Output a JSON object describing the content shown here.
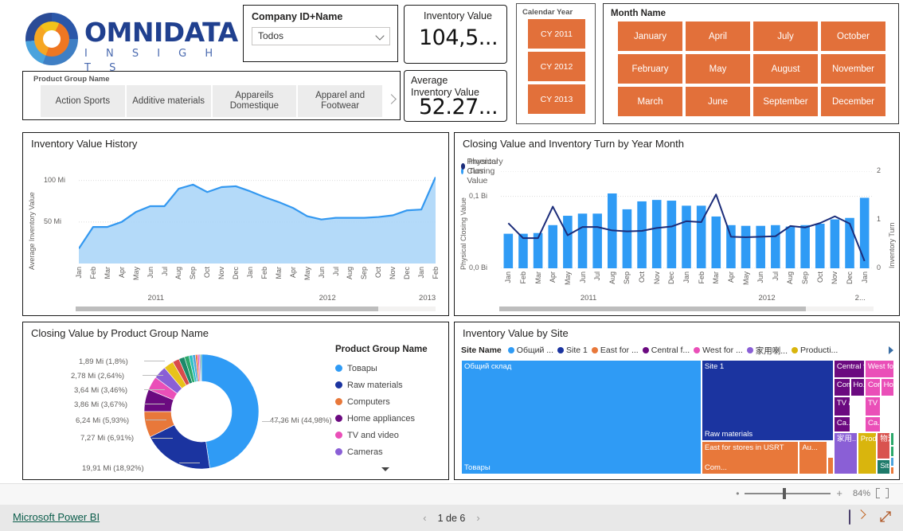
{
  "brand": {
    "name": "OMNIDATA",
    "tagline": "I N S I G H T S",
    "logo_icon": "donut-logo-icon",
    "colors": {
      "dark_blue": "#2a4b96",
      "mid_blue": "#3f7fc4",
      "light_blue": "#4aa3dd",
      "orange": "#ef7722",
      "yellow": "#f2c21a"
    }
  },
  "company_slicer": {
    "label": "Company ID+Name",
    "value": "Todos",
    "chevron": "chevron-down-icon"
  },
  "product_group_slicer": {
    "label": "Product Group Name",
    "tiles": [
      "Action Sports",
      "Additive materials",
      "Appareils Domestique",
      "Apparel and Footwear"
    ],
    "next_icon": "chevron-right-icon"
  },
  "kpi_cards": [
    {
      "label": "Inventory Value",
      "value": "104,5..."
    },
    {
      "label": "Average Inventory Value",
      "value": "52.27..."
    }
  ],
  "calendar_year_slicer": {
    "label": "Calendar Year",
    "items": [
      "CY 2011",
      "CY 2012",
      "CY 2013"
    ],
    "tile_color": "#e2703a"
  },
  "month_slicer": {
    "label": "Month Name",
    "items": [
      "January",
      "April",
      "July",
      "October",
      "February",
      "May",
      "August",
      "November",
      "March",
      "June",
      "September",
      "December"
    ],
    "tile_color": "#e2703a"
  },
  "chart_data": [
    {
      "type": "area",
      "title": "Inventory Value History",
      "xlabel": "",
      "ylabel": "Average Inventory Value",
      "ylim": [
        0,
        115
      ],
      "yticks": [
        "50 Mi",
        "100 Mi"
      ],
      "ytick_values": [
        50,
        100
      ],
      "grid": true,
      "series_color": "#3398f0",
      "fill_color": "#a7d4f8",
      "x_groups": [
        {
          "year": "2011",
          "months": [
            "Jan",
            "Feb",
            "Mar",
            "Apr",
            "May",
            "Jun",
            "Jul",
            "Aug",
            "Sep",
            "Oct",
            "Nov",
            "Dec"
          ]
        },
        {
          "year": "2012",
          "months": [
            "Jan",
            "Feb",
            "Mar",
            "Apr",
            "May",
            "Jun",
            "Jul",
            "Aug",
            "Sep",
            "Oct",
            "Nov",
            "Dec"
          ]
        },
        {
          "year": "2013",
          "months": [
            "Jan",
            "Feb"
          ]
        }
      ],
      "categories": [
        "2011 Jan",
        "2011 Feb",
        "2011 Mar",
        "2011 Apr",
        "2011 May",
        "2011 Jun",
        "2011 Jul",
        "2011 Aug",
        "2011 Sep",
        "2011 Oct",
        "2011 Nov",
        "2011 Dec",
        "2012 Jan",
        "2012 Feb",
        "2012 Mar",
        "2012 Apr",
        "2012 May",
        "2012 Jun",
        "2012 Jul",
        "2012 Aug",
        "2012 Sep",
        "2012 Oct",
        "2012 Nov",
        "2012 Dec",
        "2013 Jan",
        "2013 Feb"
      ],
      "values": [
        18,
        44,
        44,
        50,
        62,
        69,
        69,
        90,
        95,
        86,
        92,
        93,
        87,
        80,
        74,
        67,
        57,
        53,
        55,
        55,
        55,
        56,
        58,
        64,
        65,
        104
      ],
      "scrollbar": {
        "position": 0,
        "extent": 0.84
      }
    },
    {
      "type": "bar+line",
      "title": "Closing Value and Inventory Turn by Year Month",
      "legend": [
        {
          "label": "Physical Closing Value",
          "color": "#2f9bf5"
        },
        {
          "label": "Inventory Turn",
          "color": "#1c2d7a"
        }
      ],
      "legend_position": "top",
      "ylabel_left": "Physical Closing Value",
      "ylabel_right": "Inventory Turn",
      "yticks_left": [
        "0,0 Bi",
        "0,1 Bi"
      ],
      "ytick_left_values": [
        0.0,
        0.1
      ],
      "ylim_left": [
        0,
        0.135
      ],
      "yticks_right": [
        "0",
        "1",
        "2"
      ],
      "ytick_right_values": [
        0,
        1,
        2
      ],
      "ylim_right": [
        0,
        2
      ],
      "grid": true,
      "x_groups": [
        {
          "year": "2011",
          "months": [
            "Jan",
            "Feb",
            "Mar",
            "Apr",
            "May",
            "Jun",
            "Jul",
            "Aug",
            "Sep",
            "Oct",
            "Nov",
            "Dec"
          ]
        },
        {
          "year": "2012",
          "months": [
            "Jan",
            "Feb",
            "Mar",
            "Apr",
            "May",
            "Jun",
            "Jul",
            "Aug",
            "Sep",
            "Oct",
            "Nov",
            "Dec"
          ]
        },
        {
          "year": "2...",
          "months": [
            "Jan"
          ]
        }
      ],
      "categories": [
        "2011 Jan",
        "2011 Feb",
        "2011 Mar",
        "2011 Apr",
        "2011 May",
        "2011 Jun",
        "2011 Jul",
        "2011 Aug",
        "2011 Sep",
        "2011 Oct",
        "2011 Nov",
        "2011 Dec",
        "2012 Jan",
        "2012 Feb",
        "2012 Mar",
        "2012 Apr",
        "2012 May",
        "2012 Jun",
        "2012 Jul",
        "2012 Aug",
        "2012 Sep",
        "2012 Oct",
        "2012 Nov",
        "2012 Dec",
        "2013 Jan"
      ],
      "series": [
        {
          "name": "Physical Closing Value",
          "type": "bar",
          "axis": "left",
          "values": [
            0.048,
            0.048,
            0.049,
            0.06,
            0.073,
            0.076,
            0.076,
            0.104,
            0.082,
            0.093,
            0.095,
            0.094,
            0.087,
            0.087,
            0.072,
            0.06,
            0.059,
            0.059,
            0.06,
            0.058,
            0.06,
            0.062,
            0.068,
            0.07,
            0.098
          ]
        },
        {
          "name": "Inventory Turn",
          "type": "line",
          "axis": "right",
          "values": [
            0.93,
            0.62,
            0.62,
            1.27,
            0.68,
            0.85,
            0.85,
            0.78,
            0.76,
            0.77,
            0.83,
            0.86,
            0.97,
            0.95,
            1.52,
            0.65,
            0.64,
            0.65,
            0.66,
            0.87,
            0.84,
            0.93,
            1.07,
            0.92,
            0.15
          ]
        }
      ],
      "scrollbar": {
        "position": 0,
        "extent": 0.82
      }
    },
    {
      "type": "pie",
      "title": "Closing Value by Product Group Name",
      "legend_title": "Product Group Name",
      "legend_position": "right",
      "donut": true,
      "labels": [
        "47,36 Mi (44,98%)",
        "19,91 Mi (18,92%)",
        "7,27 Mi (6,91%)",
        "6,24 Mi (5,93%)",
        "3,86 Mi (3,67%)",
        "3,64 Mi (3,46%)",
        "2,78 Mi (2,64%)",
        "1,89 Mi (1,8%)"
      ],
      "slices": [
        {
          "name": "Товары",
          "value": 47.36,
          "percent": 44.98,
          "color": "#2f9bf5",
          "label": "47,36 Mi (44,98%)"
        },
        {
          "name": "Raw materials",
          "value": 19.91,
          "percent": 18.92,
          "color": "#1b34a0",
          "label": "19,91 Mi (18,92%)"
        },
        {
          "name": "Computers",
          "value": 7.27,
          "percent": 6.91,
          "color": "#e8783a",
          "label": "7,27 Mi (6,91%)"
        },
        {
          "name": "Home appliances",
          "value": 6.24,
          "percent": 5.93,
          "color": "#6b0a80",
          "label": "6,24 Mi (5,93%)"
        },
        {
          "name": "TV and video",
          "value": 3.86,
          "percent": 3.67,
          "color": "#ea4fb8",
          "label": "3,86 Mi (3,67%)"
        },
        {
          "name": "Cameras",
          "value": 3.64,
          "percent": 3.46,
          "color": "#8a5fd6",
          "label": "3,64 Mi (3,46%)"
        },
        {
          "name": "",
          "value": 2.78,
          "percent": 2.64,
          "color": "#e8c21a",
          "label": "2,78 Mi (2,64%)"
        },
        {
          "name": "",
          "value": 1.89,
          "percent": 1.8,
          "color": "#d94b4b",
          "label": "1,89 Mi (1,8%)"
        },
        {
          "name": "",
          "value": 1.6,
          "percent": 1.5,
          "color": "#1d8a6a",
          "color_note": "small",
          "label": ""
        },
        {
          "name": "",
          "value": 1.3,
          "percent": 1.2,
          "color": "#2aa86a",
          "label": ""
        },
        {
          "name": "",
          "value": 1.0,
          "percent": 0.95,
          "color": "#2fc0c0",
          "label": ""
        },
        {
          "name": "",
          "value": 0.8,
          "percent": 0.76,
          "color": "#4aa3dd",
          "label": ""
        },
        {
          "name": "",
          "value": 0.6,
          "percent": 0.57,
          "color": "#e8783a",
          "label": ""
        },
        {
          "name": "",
          "value": 0.45,
          "percent": 0.43,
          "color": "#ea4fb8",
          "label": ""
        },
        {
          "name": "",
          "value": 0.35,
          "percent": 0.33,
          "color": "#8a5fd6",
          "label": ""
        },
        {
          "name": "",
          "value": 0.3,
          "percent": 0.28,
          "color": "#2aa86a",
          "label": ""
        }
      ],
      "legend_items": [
        {
          "label": "Товары",
          "color": "#2f9bf5"
        },
        {
          "label": "Raw materials",
          "color": "#1b34a0"
        },
        {
          "label": "Computers",
          "color": "#e8783a"
        },
        {
          "label": "Home appliances",
          "color": "#6b0a80"
        },
        {
          "label": "TV and video",
          "color": "#ea4fb8"
        },
        {
          "label": "Cameras",
          "color": "#8a5fd6"
        }
      ],
      "more_icon": "chevron-down-icon"
    },
    {
      "type": "treemap",
      "title": "Inventory Value by Site",
      "legend_title": "Site Name",
      "legend_items": [
        {
          "label": "Общий ...",
          "color": "#2f9bf5"
        },
        {
          "label": "Site 1",
          "color": "#1b34a0"
        },
        {
          "label": "East for ...",
          "color": "#e8783a"
        },
        {
          "label": "Central f...",
          "color": "#6b0a80"
        },
        {
          "label": "West for ...",
          "color": "#ea4fb8"
        },
        {
          "label": "家用喇...",
          "color": "#8a5fd6"
        },
        {
          "label": "Producti...",
          "color": "#d9b50d"
        }
      ],
      "legend_next_icon": "triangle-right-icon",
      "cells": [
        {
          "label": "Общий склад",
          "sublabel": "Товары",
          "color": "#2f9bf5",
          "x": 0,
          "y": 0,
          "w": 55.5,
          "h": 100
        },
        {
          "label": "Site 1",
          "sublabel": "Raw materials",
          "color": "#1b34a0",
          "x": 55.5,
          "y": 0,
          "w": 30.5,
          "h": 71
        },
        {
          "label": "East for stores in USRT",
          "sublabel": "Com...",
          "color": "#e8783a",
          "x": 55.5,
          "y": 71,
          "w": 22.5,
          "h": 29
        },
        {
          "label": "Au...",
          "color": "#e8783a",
          "x": 78,
          "y": 71,
          "w": 6.5,
          "h": 29
        },
        {
          "label": "",
          "color": "#e8783a",
          "x": 84.5,
          "y": 85,
          "w": 1.5,
          "h": 15
        },
        {
          "label": "Central for...",
          "color": "#6b0a80",
          "x": 86,
          "y": 0,
          "w": 7.2,
          "h": 16
        },
        {
          "label": "Com...",
          "color": "#6b0a80",
          "x": 86,
          "y": 16,
          "w": 3.8,
          "h": 16
        },
        {
          "label": "Ho...",
          "color": "#6b0a80",
          "x": 89.8,
          "y": 16,
          "w": 3.4,
          "h": 16
        },
        {
          "label": "TV a...",
          "color": "#6b0a80",
          "x": 86,
          "y": 32,
          "w": 3.8,
          "h": 17
        },
        {
          "label": "Ca...",
          "color": "#6b0a80",
          "x": 86,
          "y": 49,
          "w": 3.8,
          "h": 14
        },
        {
          "label": "West for s...",
          "color": "#ea4fb8",
          "x": 93.2,
          "y": 0,
          "w": 6.8,
          "h": 16
        },
        {
          "label": "Com...",
          "color": "#ea4fb8",
          "x": 93.2,
          "y": 16,
          "w": 3.6,
          "h": 16
        },
        {
          "label": "Ho...",
          "color": "#ea4fb8",
          "x": 96.8,
          "y": 16,
          "w": 3.2,
          "h": 16
        },
        {
          "label": "TV ...",
          "color": "#ea4fb8",
          "x": 93.2,
          "y": 32,
          "w": 3.6,
          "h": 17
        },
        {
          "label": "Ca...",
          "color": "#ea4fb8",
          "x": 93.2,
          "y": 49,
          "w": 3.6,
          "h": 14
        },
        {
          "label": "家用...",
          "color": "#8a5fd6",
          "x": 86,
          "y": 63,
          "w": 5.5,
          "h": 37
        },
        {
          "label": "Prod...",
          "color": "#d9b50d",
          "x": 91.5,
          "y": 63,
          "w": 4.5,
          "h": 37
        },
        {
          "label": "物流...",
          "color": "#d9534f",
          "x": 96,
          "y": 63,
          "w": 3,
          "h": 24
        },
        {
          "label": "Site ...",
          "color": "#1d7a6a",
          "x": 96,
          "y": 87,
          "w": 3,
          "h": 13
        },
        {
          "label": "",
          "color": "#2aa86a",
          "x": 99,
          "y": 63,
          "w": 1,
          "h": 12
        },
        {
          "label": "",
          "color": "#2aa86a",
          "x": 99,
          "y": 75,
          "w": 1,
          "h": 10
        },
        {
          "label": "",
          "color": "#4aa3dd",
          "x": 99,
          "y": 85,
          "w": 1,
          "h": 8
        },
        {
          "label": "",
          "color": "#e8783a",
          "x": 99,
          "y": 93,
          "w": 1,
          "h": 7
        }
      ]
    }
  ],
  "zoom_bar": {
    "minus_icon": "minus-icon",
    "plus_icon": "plus-icon",
    "percent": "84%",
    "fit_icon": "fit-to-page-icon",
    "slider_value": 84
  },
  "footer": {
    "link": "Microsoft Power BI",
    "prev_icon": "chevron-left-icon",
    "page": "1 de 6",
    "next_icon": "chevron-right-icon",
    "share_icon": "share-icon",
    "fullscreen_icon": "fullscreen-icon"
  }
}
